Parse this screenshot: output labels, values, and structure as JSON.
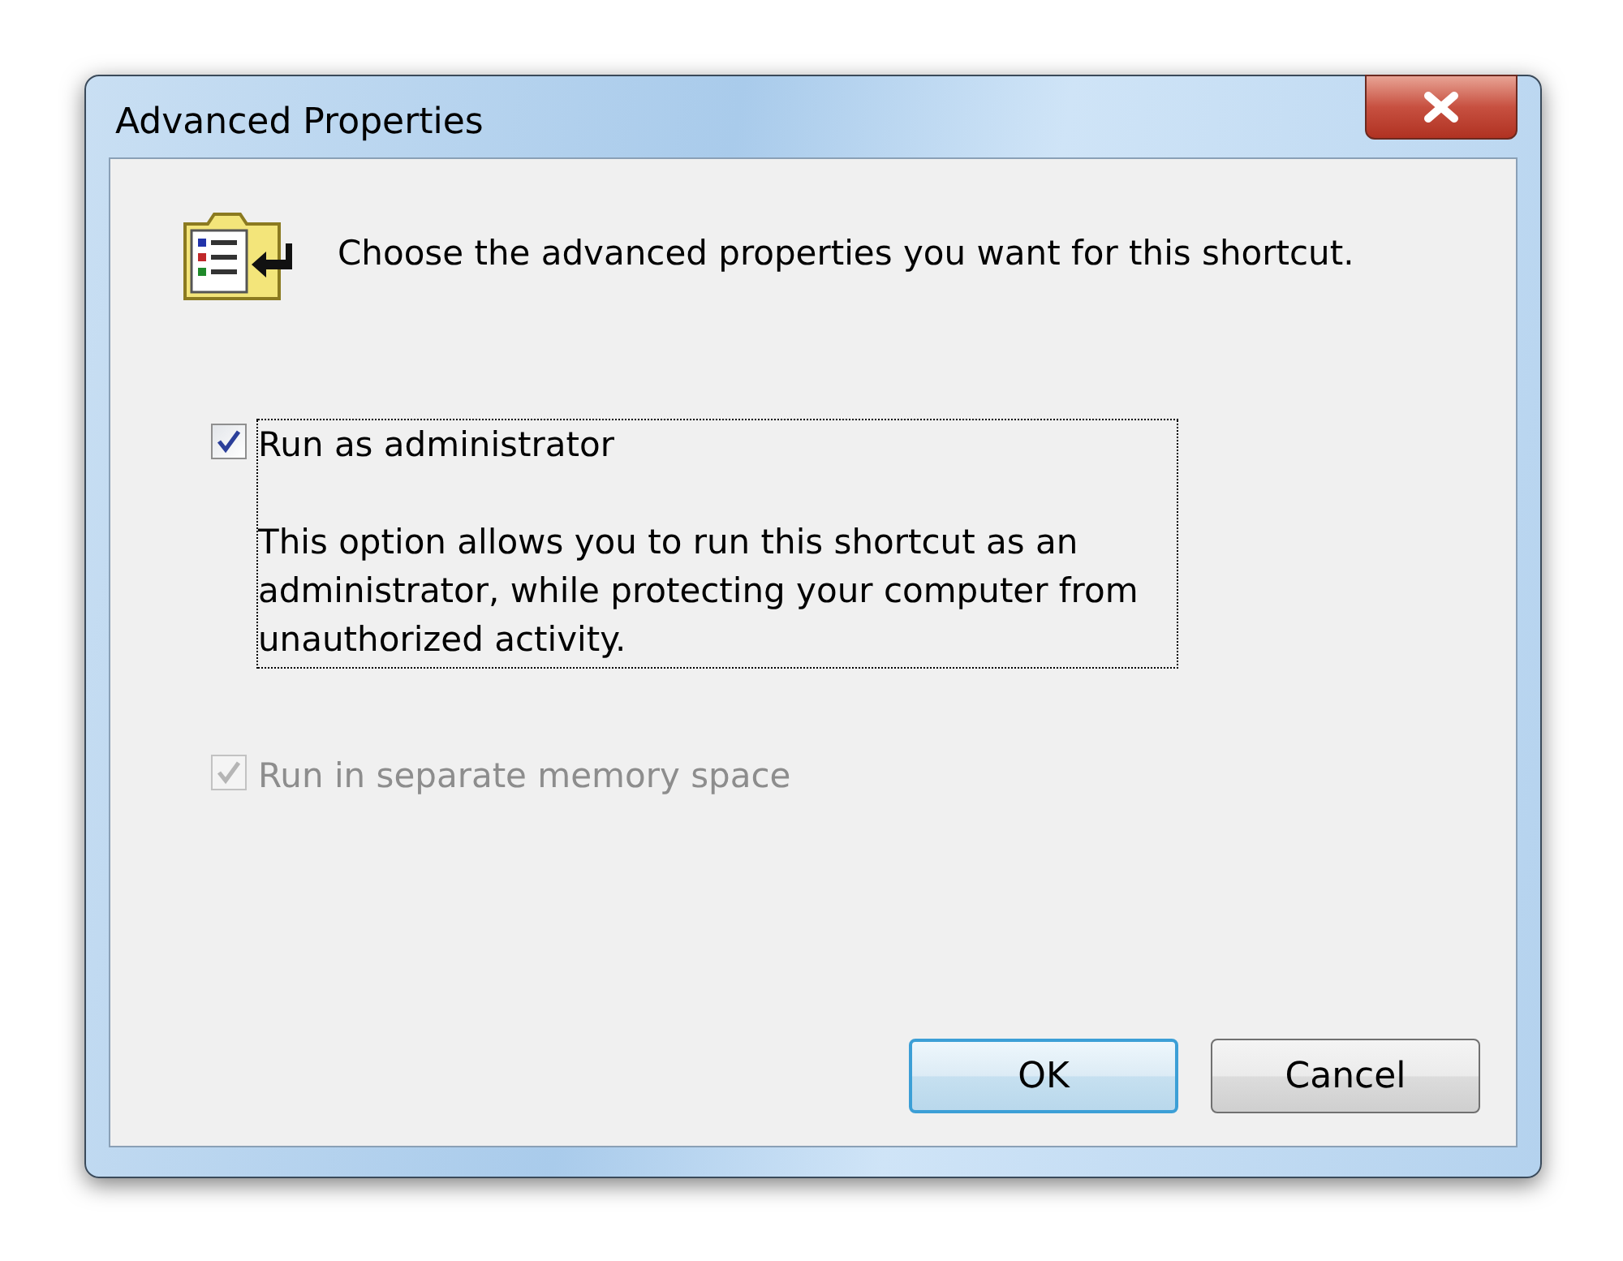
{
  "window": {
    "title": "Advanced Properties"
  },
  "header": {
    "text": "Choose the advanced properties you want for this shortcut."
  },
  "options": [
    {
      "label": "Run as administrator",
      "description": "This option allows you to run this shortcut as an administrator, while protecting your computer from unauthorized activity.",
      "checked": true,
      "disabled": false,
      "focused": true
    },
    {
      "label": "Run in separate memory space",
      "checked": true,
      "disabled": true,
      "focused": false
    }
  ],
  "buttons": [
    {
      "label": "OK",
      "default": true
    },
    {
      "label": "Cancel",
      "default": false
    }
  ]
}
